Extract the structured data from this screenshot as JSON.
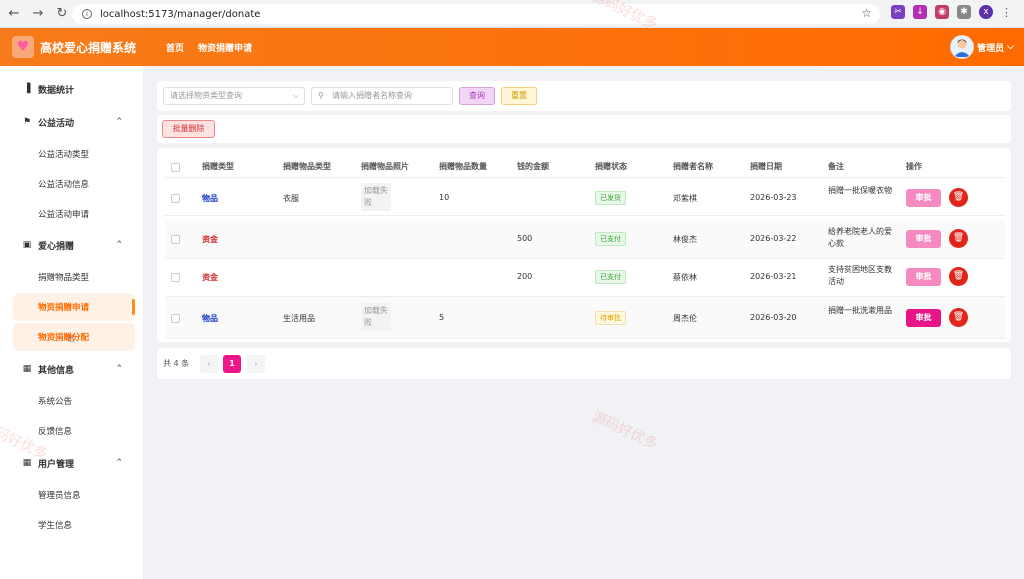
{
  "browser": {
    "url": "localhost:5173/manager/donate"
  },
  "header": {
    "system_name": "高校爱心捐赠系统",
    "nav": [
      "首页",
      "物资捐赠申请"
    ],
    "user_name": "管理员"
  },
  "sidebar": {
    "items": [
      {
        "label": "数据统计"
      },
      {
        "label": "公益活动"
      },
      {
        "label": "公益活动类型"
      },
      {
        "label": "公益活动信息"
      },
      {
        "label": "公益活动申请"
      },
      {
        "label": "爱心捐赠"
      },
      {
        "label": "捐赠物品类型"
      },
      {
        "label": "物资捐赠申请"
      },
      {
        "label": "物资捐赠分配"
      },
      {
        "label": "其他信息"
      },
      {
        "label": "系统公告"
      },
      {
        "label": "反馈信息"
      },
      {
        "label": "用户管理"
      },
      {
        "label": "管理员信息"
      },
      {
        "label": "学生信息"
      }
    ]
  },
  "search": {
    "type_placeholder": "请选择物资类型查询",
    "name_placeholder": "请输入捐赠者名称查询",
    "query_label": "查询",
    "reset_label": "重置"
  },
  "actions": {
    "batch_delete_label": "批量删除"
  },
  "table": {
    "columns": [
      "捐赠类型",
      "捐赠物品类型",
      "捐赠物品照片",
      "捐赠物品数量",
      "钱的金额",
      "捐赠状态",
      "捐赠者名称",
      "捐赠日期",
      "备注",
      "操作"
    ],
    "approve_label": "审批",
    "rows": [
      {
        "type": "物品",
        "goods_type": "衣服",
        "photo": "加载失败",
        "quantity": "10",
        "amount": "",
        "status": "已发货",
        "donor": "邓紫棋",
        "date": "2026-03-23",
        "note": "捐赠一批保暖衣物"
      },
      {
        "type": "资金",
        "goods_type": "",
        "photo": "",
        "quantity": "",
        "amount": "500",
        "status": "已支付",
        "donor": "林俊杰",
        "date": "2026-03-22",
        "note": "给养老院老人的爱心款"
      },
      {
        "type": "资金",
        "goods_type": "",
        "photo": "",
        "quantity": "",
        "amount": "200",
        "status": "已支付",
        "donor": "蔡依林",
        "date": "2026-03-21",
        "note": "支持贫困地区支教活动"
      },
      {
        "type": "物品",
        "goods_type": "生活用品",
        "photo": "加载失败",
        "quantity": "5",
        "amount": "",
        "status": "待审批",
        "donor": "周杰伦",
        "date": "2026-03-20",
        "note": "捐赠一批洗漱用品"
      }
    ]
  },
  "pager": {
    "total": "共 4 条",
    "prev": "‹",
    "current": "1",
    "next": "›"
  },
  "watermark": "源码好优多",
  "colors": {
    "header": "#ff6a00",
    "accent": "#f0168a"
  }
}
